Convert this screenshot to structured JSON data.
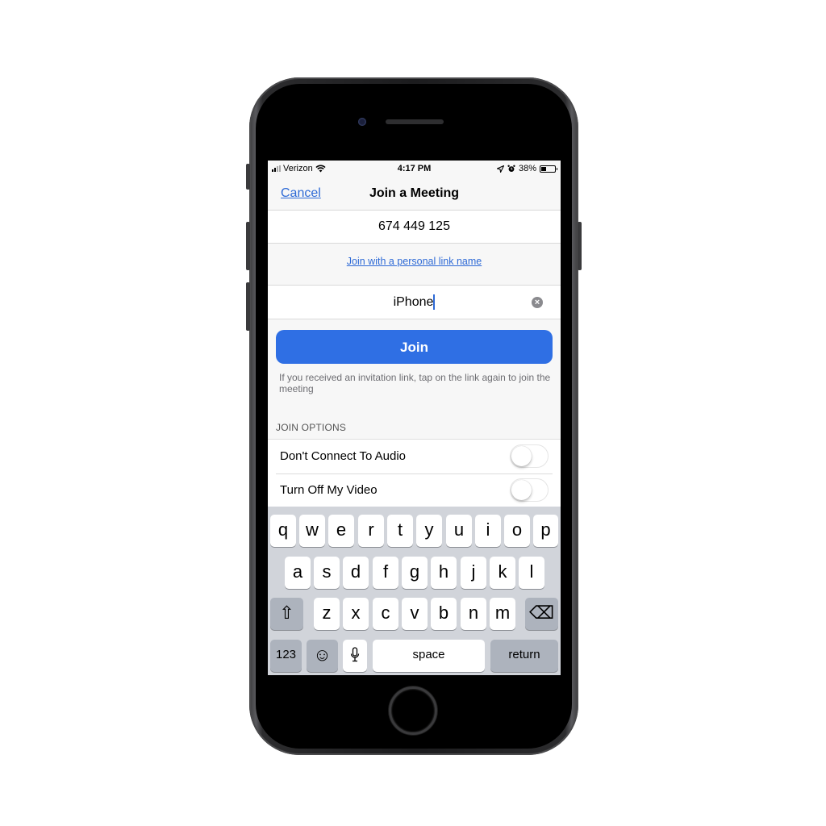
{
  "status_bar": {
    "carrier": "Verizon",
    "time": "4:17 PM",
    "battery_percent": "38%",
    "battery_level": 0.38,
    "icons": [
      "signal-icon",
      "wifi-icon",
      "location-icon",
      "alarm-icon",
      "battery-icon"
    ]
  },
  "navbar": {
    "cancel_label": "Cancel",
    "title": "Join a Meeting"
  },
  "form": {
    "meeting_id_value": "674 449 125",
    "personal_link_label": "Join with a personal link name",
    "name_value": "iPhone",
    "clear_icon": "×",
    "join_label": "Join",
    "hint_text": "If you received an invitation link, tap on the link again to join the meeting"
  },
  "options": {
    "header": "JOIN OPTIONS",
    "items": [
      {
        "label": "Don't Connect To Audio",
        "on": false
      },
      {
        "label": "Turn Off My Video",
        "on": false
      }
    ]
  },
  "keyboard": {
    "row1": [
      "q",
      "w",
      "e",
      "r",
      "t",
      "y",
      "u",
      "i",
      "o",
      "p"
    ],
    "row2": [
      "a",
      "s",
      "d",
      "f",
      "g",
      "h",
      "j",
      "k",
      "l"
    ],
    "row3": [
      "z",
      "x",
      "c",
      "v",
      "b",
      "n",
      "m"
    ],
    "shift_icon": "⇧",
    "delete_icon": "⌫",
    "numbers_label": "123",
    "emoji_icon": "☺",
    "mic_icon": "🎙",
    "space_label": "space",
    "return_label": "return"
  },
  "colors": {
    "accent": "#2f6fe4",
    "link": "#2e6ad6",
    "keyboard_bg": "#d1d4da"
  }
}
